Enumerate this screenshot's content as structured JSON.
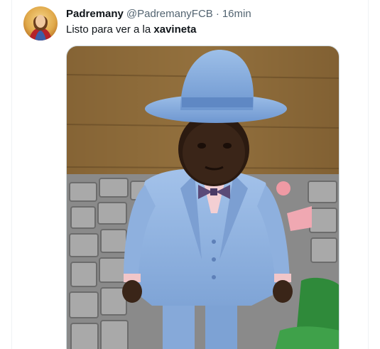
{
  "tweet": {
    "author_name": "Padremany",
    "author_handle": "@PadremanyFCB",
    "separator": "·",
    "time": "16min",
    "text_prefix": "Listo para ver a la ",
    "text_bold": "xavineta"
  },
  "icons": {
    "avatar": "avatar-image",
    "photo": "toddler-in-blue-suit-photo"
  },
  "colors": {
    "primary_text": "#0f1419",
    "secondary_text": "#536471",
    "border": "#cfd9de",
    "suit_blue": "#8fb3e0"
  }
}
